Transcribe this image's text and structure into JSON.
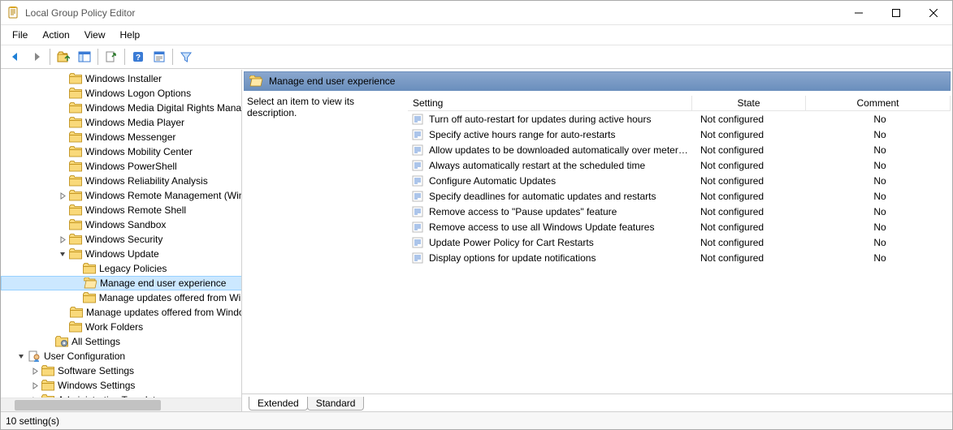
{
  "window": {
    "title": "Local Group Policy Editor"
  },
  "menu": {
    "file": "File",
    "action": "Action",
    "view": "View",
    "help": "Help"
  },
  "tree": {
    "items": [
      {
        "indent": 4,
        "exp": "",
        "icon": "folder",
        "label": "Windows Installer"
      },
      {
        "indent": 4,
        "exp": "",
        "icon": "folder",
        "label": "Windows Logon Options"
      },
      {
        "indent": 4,
        "exp": "",
        "icon": "folder",
        "label": "Windows Media Digital Rights Management"
      },
      {
        "indent": 4,
        "exp": "",
        "icon": "folder",
        "label": "Windows Media Player"
      },
      {
        "indent": 4,
        "exp": "",
        "icon": "folder",
        "label": "Windows Messenger"
      },
      {
        "indent": 4,
        "exp": "",
        "icon": "folder",
        "label": "Windows Mobility Center"
      },
      {
        "indent": 4,
        "exp": "",
        "icon": "folder",
        "label": "Windows PowerShell"
      },
      {
        "indent": 4,
        "exp": "",
        "icon": "folder",
        "label": "Windows Reliability Analysis"
      },
      {
        "indent": 4,
        "exp": ">",
        "icon": "folder",
        "label": "Windows Remote Management (WinRM)"
      },
      {
        "indent": 4,
        "exp": "",
        "icon": "folder",
        "label": "Windows Remote Shell"
      },
      {
        "indent": 4,
        "exp": "",
        "icon": "folder",
        "label": "Windows Sandbox"
      },
      {
        "indent": 4,
        "exp": ">",
        "icon": "folder",
        "label": "Windows Security"
      },
      {
        "indent": 4,
        "exp": "v",
        "icon": "folder",
        "label": "Windows Update"
      },
      {
        "indent": 5,
        "exp": "",
        "icon": "folder",
        "label": "Legacy Policies"
      },
      {
        "indent": 5,
        "exp": "",
        "icon": "folder-open",
        "label": "Manage end user experience",
        "selected": true
      },
      {
        "indent": 5,
        "exp": "",
        "icon": "folder",
        "label": "Manage updates offered from Windows Update"
      },
      {
        "indent": 5,
        "exp": "",
        "icon": "folder",
        "label": "Manage updates offered from Windows Server Update Service"
      },
      {
        "indent": 4,
        "exp": "",
        "icon": "folder",
        "label": "Work Folders"
      },
      {
        "indent": 3,
        "exp": "",
        "icon": "settings",
        "label": "All Settings"
      },
      {
        "indent": 1,
        "exp": "v",
        "icon": "user",
        "label": "User Configuration"
      },
      {
        "indent": 2,
        "exp": ">",
        "icon": "folder",
        "label": "Software Settings"
      },
      {
        "indent": 2,
        "exp": ">",
        "icon": "folder",
        "label": "Windows Settings"
      },
      {
        "indent": 2,
        "exp": ">",
        "icon": "folder",
        "label": "Administrative Templates"
      }
    ]
  },
  "content": {
    "header": "Manage end user experience",
    "description_prompt": "Select an item to view its description.",
    "columns": {
      "setting": "Setting",
      "state": "State",
      "comment": "Comment"
    },
    "rows": [
      {
        "setting": "Turn off auto-restart for updates during active hours",
        "state": "Not configured",
        "comment": "No"
      },
      {
        "setting": "Specify active hours range for auto-restarts",
        "state": "Not configured",
        "comment": "No"
      },
      {
        "setting": "Allow updates to be downloaded automatically over metere...",
        "state": "Not configured",
        "comment": "No"
      },
      {
        "setting": "Always automatically restart at the scheduled time",
        "state": "Not configured",
        "comment": "No"
      },
      {
        "setting": "Configure Automatic Updates",
        "state": "Not configured",
        "comment": "No"
      },
      {
        "setting": "Specify deadlines for automatic updates and restarts",
        "state": "Not configured",
        "comment": "No"
      },
      {
        "setting": "Remove access to \"Pause updates\" feature",
        "state": "Not configured",
        "comment": "No"
      },
      {
        "setting": "Remove access to use all Windows Update features",
        "state": "Not configured",
        "comment": "No"
      },
      {
        "setting": "Update Power Policy for Cart Restarts",
        "state": "Not configured",
        "comment": "No"
      },
      {
        "setting": "Display options for update notifications",
        "state": "Not configured",
        "comment": "No"
      }
    ]
  },
  "tabs": {
    "extended": "Extended",
    "standard": "Standard"
  },
  "status": {
    "text": "10 setting(s)"
  }
}
